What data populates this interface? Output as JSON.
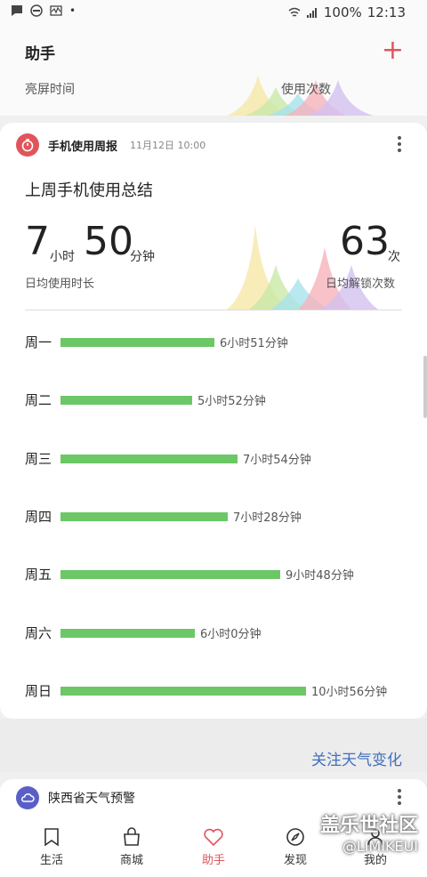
{
  "status_bar": {
    "battery": "100%",
    "time": "12:13"
  },
  "header": {
    "title": "助手",
    "tab_screen_time": "亮屏时间",
    "tab_usage_count": "使用次数"
  },
  "report": {
    "name": "手机使用周报",
    "date": "11月12日 10:00",
    "summary_title": "上周手机使用总结",
    "hours": "7",
    "hours_unit": "小时",
    "minutes": "50",
    "minutes_unit": "分钟",
    "avg_usage_label": "日均使用时长",
    "unlocks": "63",
    "unlocks_unit": "次",
    "avg_unlock_label": "日均解锁次数",
    "days": [
      {
        "label": "周一",
        "value": "6小时51分钟",
        "minutes": 411
      },
      {
        "label": "周二",
        "value": "5小时52分钟",
        "minutes": 352
      },
      {
        "label": "周三",
        "value": "7小时54分钟",
        "minutes": 474
      },
      {
        "label": "周四",
        "value": "7小时28分钟",
        "minutes": 448
      },
      {
        "label": "周五",
        "value": "9小时48分钟",
        "minutes": 588
      },
      {
        "label": "周六",
        "value": "6小时0分钟",
        "minutes": 360
      },
      {
        "label": "周日",
        "value": "10小时56分钟",
        "minutes": 656
      }
    ]
  },
  "follow_link": "关注天气变化",
  "weather_card": {
    "title": "陕西省天气预警"
  },
  "nav": {
    "life": "生活",
    "mall": "商城",
    "assistant": "助手",
    "discover": "发现",
    "mine": "我的"
  },
  "watermark": {
    "line1": "盖乐世社区",
    "line2": "@LIMIKEUI"
  },
  "colors": {
    "accent": "#e0555b",
    "bar": "#6cc766",
    "link": "#3f6fbf"
  }
}
